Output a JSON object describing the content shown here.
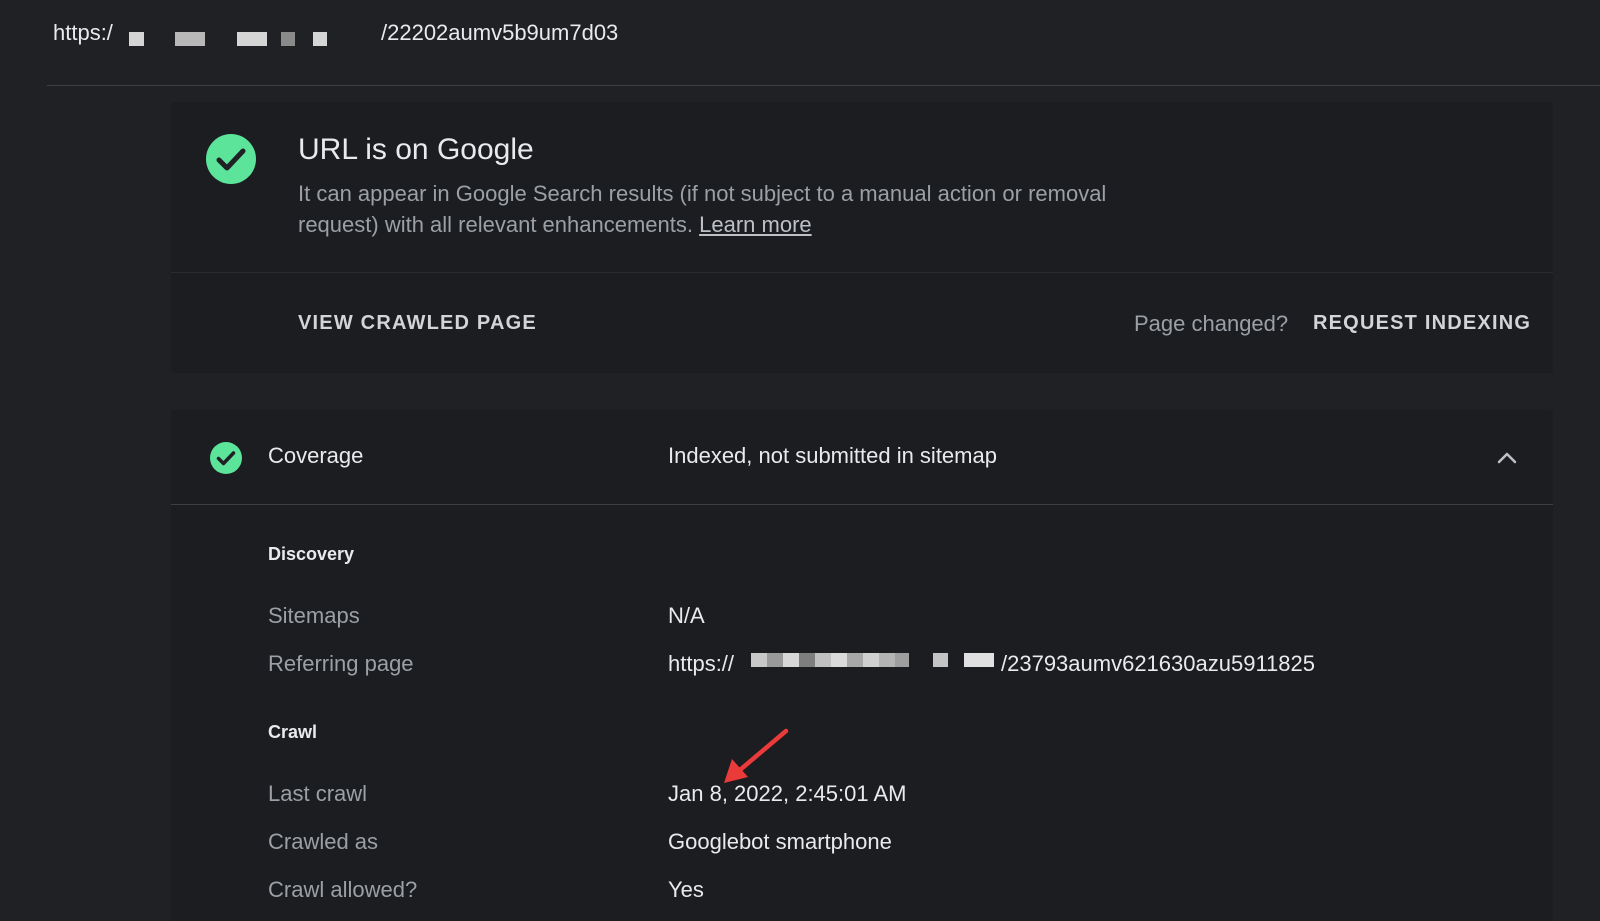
{
  "url_bar": {
    "prefix": "https:/",
    "suffix": "/22202aumv5b9um7d03"
  },
  "status": {
    "icon": "check-circle-icon",
    "title": "URL is on Google",
    "description": "It can appear in Google Search results (if not subject to a manual action or removal request) with all relevant enhancements.",
    "learn_more": "Learn more",
    "view_crawled": "VIEW CRAWLED PAGE",
    "page_changed": "Page changed?",
    "request_indexing": "REQUEST INDEXING",
    "accent_color": "#5ce59a"
  },
  "coverage": {
    "label": "Coverage",
    "value": "Indexed, not submitted in sitemap",
    "expand_icon": "chevron-up-icon",
    "discovery": {
      "heading": "Discovery",
      "rows": [
        {
          "label": "Sitemaps",
          "value": "N/A"
        },
        {
          "label": "Referring page",
          "value_prefix": "https://",
          "value_suffix": "/23793aumv621630azu5911825"
        }
      ]
    },
    "crawl": {
      "heading": "Crawl",
      "rows": [
        {
          "label": "Last crawl",
          "value": "Jan 8, 2022, 2:45:01 AM"
        },
        {
          "label": "Crawled as",
          "value": "Googlebot smartphone"
        },
        {
          "label": "Crawl allowed?",
          "value": "Yes"
        }
      ]
    }
  },
  "annotation": {
    "icon": "red-arrow-icon",
    "color": "#ea3a3a"
  }
}
